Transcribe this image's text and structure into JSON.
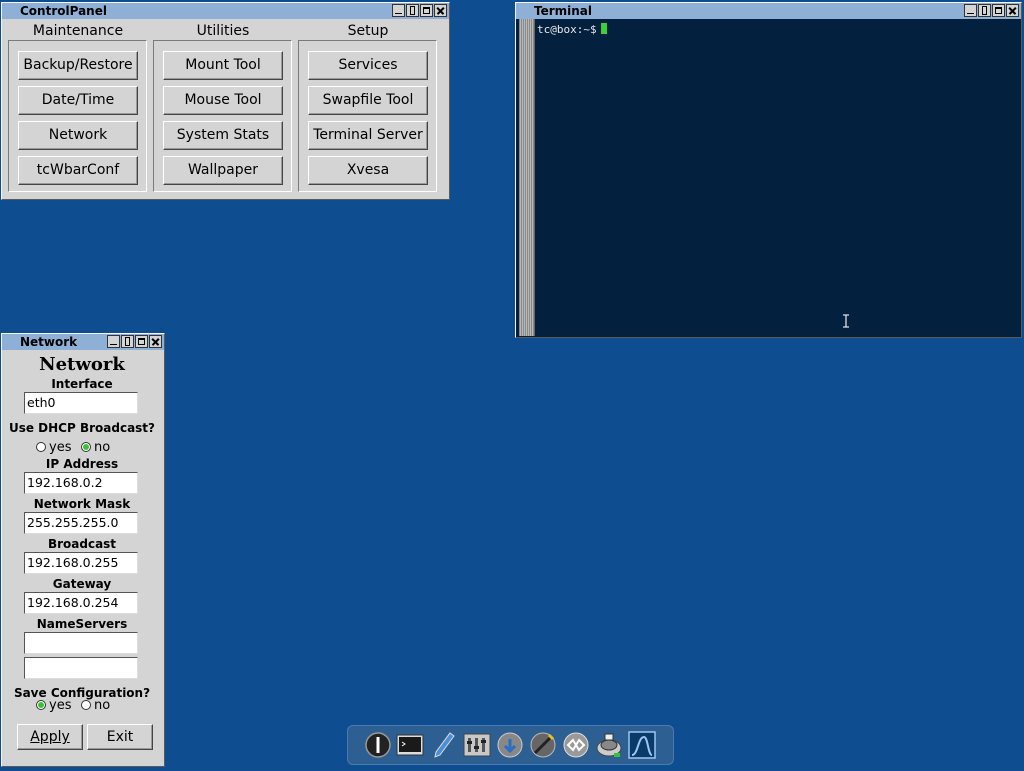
{
  "control_panel": {
    "title": "ControlPanel",
    "columns": [
      {
        "title": "Maintenance",
        "buttons": [
          "Backup/Restore",
          "Date/Time",
          "Network",
          "tcWbarConf"
        ]
      },
      {
        "title": "Utilities",
        "buttons": [
          "Mount Tool",
          "Mouse Tool",
          "System Stats",
          "Wallpaper"
        ]
      },
      {
        "title": "Setup",
        "buttons": [
          "Services",
          "Swapfile Tool",
          "Terminal Server",
          "Xvesa"
        ]
      }
    ]
  },
  "terminal": {
    "title": "Terminal",
    "prompt": "tc@box:~$"
  },
  "network": {
    "title": "Network",
    "heading": "Network",
    "interface_label": "Interface",
    "interface_value": "eth0",
    "dhcp_label": "Use DHCP Broadcast?",
    "dhcp_yes": "yes",
    "dhcp_no": "no",
    "dhcp_selected": "no",
    "ip_label": "IP Address",
    "ip_value": "192.168.0.2",
    "mask_label": "Network Mask",
    "mask_value": "255.255.255.0",
    "broadcast_label": "Broadcast",
    "broadcast_value": "192.168.0.255",
    "gateway_label": "Gateway",
    "gateway_value": "192.168.0.254",
    "nameservers_label": "NameServers",
    "nameserver1_value": "",
    "nameserver2_value": "",
    "save_label": "Save Configuration?",
    "save_yes": "yes",
    "save_no": "no",
    "save_selected": "yes",
    "apply_label": "Apply",
    "exit_label": "Exit"
  },
  "taskbar": {
    "icons": [
      "exit-icon",
      "terminal-icon",
      "editor-icon",
      "control-panel-icon",
      "apps-browser-icon",
      "mount-tool-icon",
      "services-icon",
      "backup-icon",
      "system-stats-icon"
    ]
  },
  "colors": {
    "desktop": "#0e4d8f",
    "titlebar": "#8fb0d6",
    "terminal_bg": "#04203f",
    "radio_on": "#38c238"
  }
}
